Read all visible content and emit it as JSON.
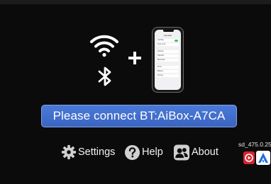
{
  "main": {
    "connect_banner": "Please connect BT:AiBox-A7CA"
  },
  "menu": {
    "settings_label": "Settings",
    "help_label": "Help",
    "about_label": "About"
  },
  "footer": {
    "version": "sd_475.0.25"
  },
  "phone_illustration": {
    "screen_title": "General",
    "rows": [
      "CarPlay",
      "Auto Lock",
      "AirDrop",
      "Handoff",
      "Bluetooth",
      "Wi-Fi",
      "Battery",
      "Privacy"
    ]
  },
  "icons": {
    "wifi": "wifi-icon",
    "bluetooth": "bluetooth-icon",
    "plus": "plus-icon",
    "settings": "gear-icon",
    "help": "question-icon",
    "about": "people-icon",
    "app_red": "video-app-icon",
    "app_blue": "arrow-app-icon"
  },
  "colors": {
    "background": "#0b0b0b",
    "banner": "#4470d0",
    "badge_red": "#d3262e",
    "badge_blue": "#1f6fd6"
  }
}
